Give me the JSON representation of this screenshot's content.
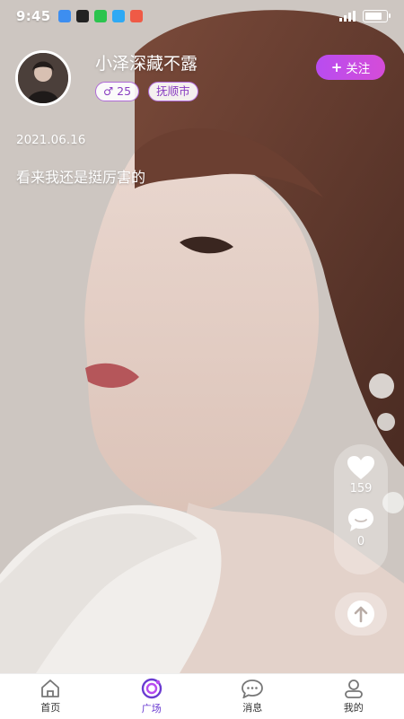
{
  "status_bar": {
    "time": "9:45"
  },
  "post": {
    "username": "小泽深藏不露",
    "gender_age": "♂ 25",
    "city": "抚顺市",
    "follow_label": "关注",
    "date": "2021.06.16",
    "caption": "看来我还是挺厉害的"
  },
  "actions": {
    "likes": "159",
    "comments": "0"
  },
  "tabbar": {
    "items": [
      {
        "label": "首页",
        "icon": "home-icon"
      },
      {
        "label": "广场",
        "icon": "plaza-icon"
      },
      {
        "label": "消息",
        "icon": "message-icon"
      },
      {
        "label": "我的",
        "icon": "profile-icon"
      }
    ],
    "active": "广场"
  },
  "colors": {
    "accent": "#b84cf0",
    "tag_border": "#b06bd8",
    "active_tab": "#6a3bd1"
  }
}
